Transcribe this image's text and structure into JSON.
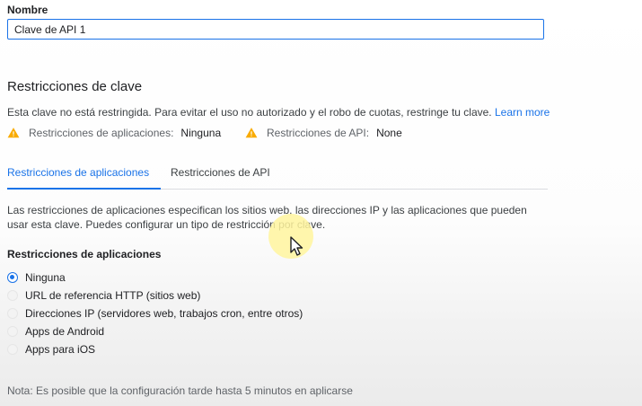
{
  "name_field": {
    "label": "Nombre",
    "value": "Clave de API 1"
  },
  "key_restrictions": {
    "heading": "Restricciones de clave",
    "description": "Esta clave no está restringida. Para evitar el uso no autorizado y el robo de cuotas, restringe tu clave.",
    "learn_more": "Learn more",
    "status": [
      {
        "key": "Restricciones de aplicaciones:",
        "value": "Ninguna",
        "icon": "warning-icon"
      },
      {
        "key": "Restricciones de API:",
        "value": "None",
        "icon": "warning-icon"
      }
    ]
  },
  "tabs": [
    {
      "label": "Restricciones de aplicaciones",
      "active": true
    },
    {
      "label": "Restricciones de API",
      "active": false
    }
  ],
  "app_restrictions": {
    "intro": "Las restricciones de aplicaciones especifican los sitios web, las direcciones IP y las aplicaciones que pueden usar esta clave. Puedes configurar un tipo de restricción por clave.",
    "heading": "Restricciones de aplicaciones",
    "options": [
      {
        "label": "Ninguna",
        "selected": true
      },
      {
        "label": "URL de referencia HTTP (sitios web)",
        "selected": false
      },
      {
        "label": "Direcciones IP (servidores web, trabajos cron, entre otros)",
        "selected": false
      },
      {
        "label": "Apps de Android",
        "selected": false
      },
      {
        "label": "Apps para iOS",
        "selected": false
      }
    ]
  },
  "note": "Nota: Es posible que la configuración tarde hasta 5 minutos en aplicarse",
  "colors": {
    "accent": "#1a73e8",
    "warning": "#f9ab00",
    "cursor_highlight": "#fff176"
  }
}
